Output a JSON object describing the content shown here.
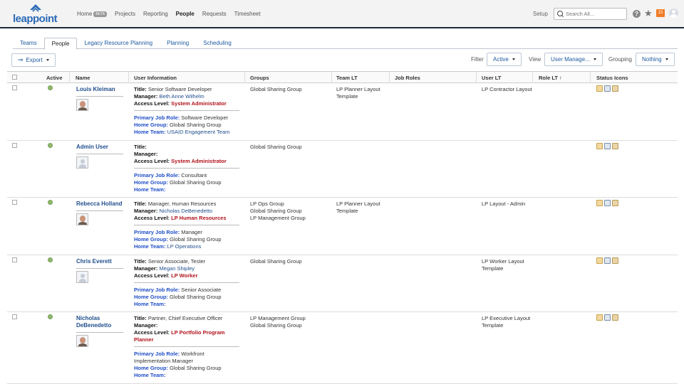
{
  "brand": {
    "logo_text": "leappoint"
  },
  "nav": {
    "items": [
      {
        "label": "Home",
        "badge": "BETA"
      },
      {
        "label": "Projects"
      },
      {
        "label": "Reporting"
      },
      {
        "label": "People"
      },
      {
        "label": "Requests"
      },
      {
        "label": "Timesheet"
      }
    ],
    "active": "People",
    "setup": "Setup",
    "search_placeholder": "Search All...",
    "notifications": "15"
  },
  "tabs": [
    "Teams",
    "People",
    "Legacy Resource Planning",
    "Planning",
    "Scheduling"
  ],
  "active_tab": "People",
  "toolbar": {
    "export": "Export",
    "filter_label": "Filter",
    "filter_value": "Active",
    "view_label": "View",
    "view_value": "User Manage...",
    "grouping_label": "Grouping",
    "grouping_value": "Nothing"
  },
  "columns": [
    "Active",
    "Name",
    "User Information",
    "Groups",
    "Team LT",
    "Job Roles",
    "User LT",
    "Role LT ↑",
    "Status Icons"
  ],
  "labels": {
    "title": "Title:",
    "manager": "Manager:",
    "access": "Access Level:",
    "role": "Primary Job Role:",
    "group": "Home Group:",
    "team": "Home Team:"
  },
  "rows": [
    {
      "name": "Louis Kleiman",
      "photo": "face",
      "title": "Senior Software Developer",
      "manager": "Beth Anne Wilhelm",
      "access": "System Administrator",
      "role": "Software Developer",
      "home_group": "Global Sharing Group",
      "home_team": "USAID Engagement Team",
      "groups": [
        "Global Sharing Group"
      ],
      "team_lt": "LP Planner Layout Template",
      "user_lt": "LP Contractor Layout"
    },
    {
      "name": "Admin User",
      "photo": "default",
      "title": "",
      "manager": "",
      "access": "System Administrator",
      "role": "Consultant",
      "home_group": "Global Sharing Group",
      "home_team": "",
      "groups": [
        "Global Sharing Group"
      ],
      "team_lt": "",
      "user_lt": ""
    },
    {
      "name": "Rebecca Holland",
      "photo": "face",
      "title": "Manager, Human Resources",
      "manager": "Nicholas DeBenedetto",
      "access": "LP Human Resources",
      "role": "Manager",
      "home_group": "Global Sharing Group",
      "home_team": "LP Operations",
      "groups": [
        "LP Ops Group",
        "Global Sharing Group",
        "LP Management Group"
      ],
      "team_lt": "LP Planner Layout Template",
      "user_lt": "LP Layout - Admin"
    },
    {
      "name": "Chris Everett",
      "photo": "default",
      "title": "Senior Associate, Tester",
      "manager": "Megan Shipley",
      "access": "LP Worker",
      "role": "Senior Associate",
      "home_group": "Global Sharing Group",
      "home_team": "",
      "groups": [
        "Global Sharing Group"
      ],
      "team_lt": "",
      "user_lt": "LP Worker Layout Template"
    },
    {
      "name": "Nicholas DeBenedetto",
      "photo": "face",
      "title": "Partner, Chief Executive Officer",
      "manager": "",
      "access": "LP Portfolio Program Planner",
      "role": "Workfront Implementation Manager",
      "home_group": "Global Sharing Group",
      "home_team": "",
      "groups": [
        "LP Management Group",
        "Global Sharing Group"
      ],
      "team_lt": "",
      "user_lt": "LP Executive Layout Template"
    }
  ]
}
